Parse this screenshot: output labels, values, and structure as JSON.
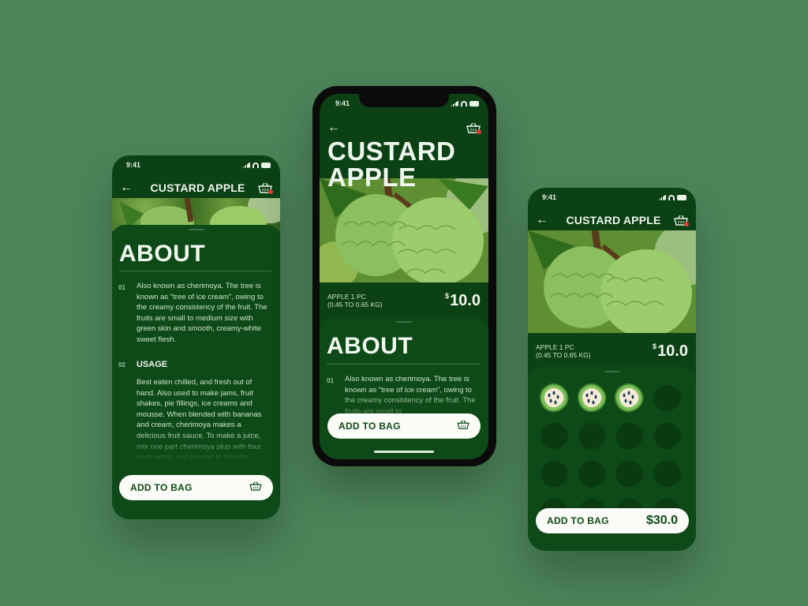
{
  "status": {
    "time": "9:41"
  },
  "left_screen": {
    "title": "CUSTARD APPLE",
    "about_heading": "ABOUT",
    "item1_number": "01",
    "item1_text": "Also known as cherimoya. The tree is known as \"tree of ice cream\", owing to the creamy consistency of the fruit. The fruits are small to medium size with green skin and smooth, creamy-white sweet flesh.",
    "item2_number": "02",
    "item2_heading": "USAGE",
    "item2_text": "Best eaten chilled, and fresh out of hand. Also used to make jams, fruit shakes, pie fillings, ice creams and mousse. When blended with bananas and cream, cherimoya makes a delicious fruit sauce. To make a juice, mix one part cherimoya plup with four parts water and pureed in blender.",
    "add_button": "ADD TO BAG"
  },
  "middle_screen": {
    "title_line1": "CUSTARD",
    "title_line2": "APPLE",
    "price_desc_line1": "APPLE 1 PC",
    "price_desc_line2": "(0.45 TO 0.65 KG)",
    "currency": "$",
    "price": "10.0",
    "about_heading": "ABOUT",
    "item1_number": "01",
    "item1_text": "Also known as cherimoya. The tree is known as \"tree of ice cream\", owing to the creamy consistency of the fruit. The fruits are small to",
    "add_button": "ADD TO BAG"
  },
  "right_screen": {
    "title": "CUSTARD APPLE",
    "price_desc_line1": "APPLE 1 PC",
    "price_desc_line2": "(0.45 TO 0.65 KG)",
    "currency": "$",
    "price": "10.0",
    "quantity_selected": 3,
    "quantity_max": 16,
    "add_button": "ADD TO BAG",
    "total": "$30.0"
  },
  "colors": {
    "background": "#4e845a",
    "screen": "#0c4015",
    "sheet": "#0d4a18",
    "button": "#fbfbf7",
    "badge": "#e63a2e"
  },
  "icons": [
    "back-arrow-icon",
    "basket-icon",
    "signal-icon",
    "wifi-icon",
    "battery-icon",
    "custard-apple-slice-icon",
    "leaf-placeholder-icon"
  ]
}
